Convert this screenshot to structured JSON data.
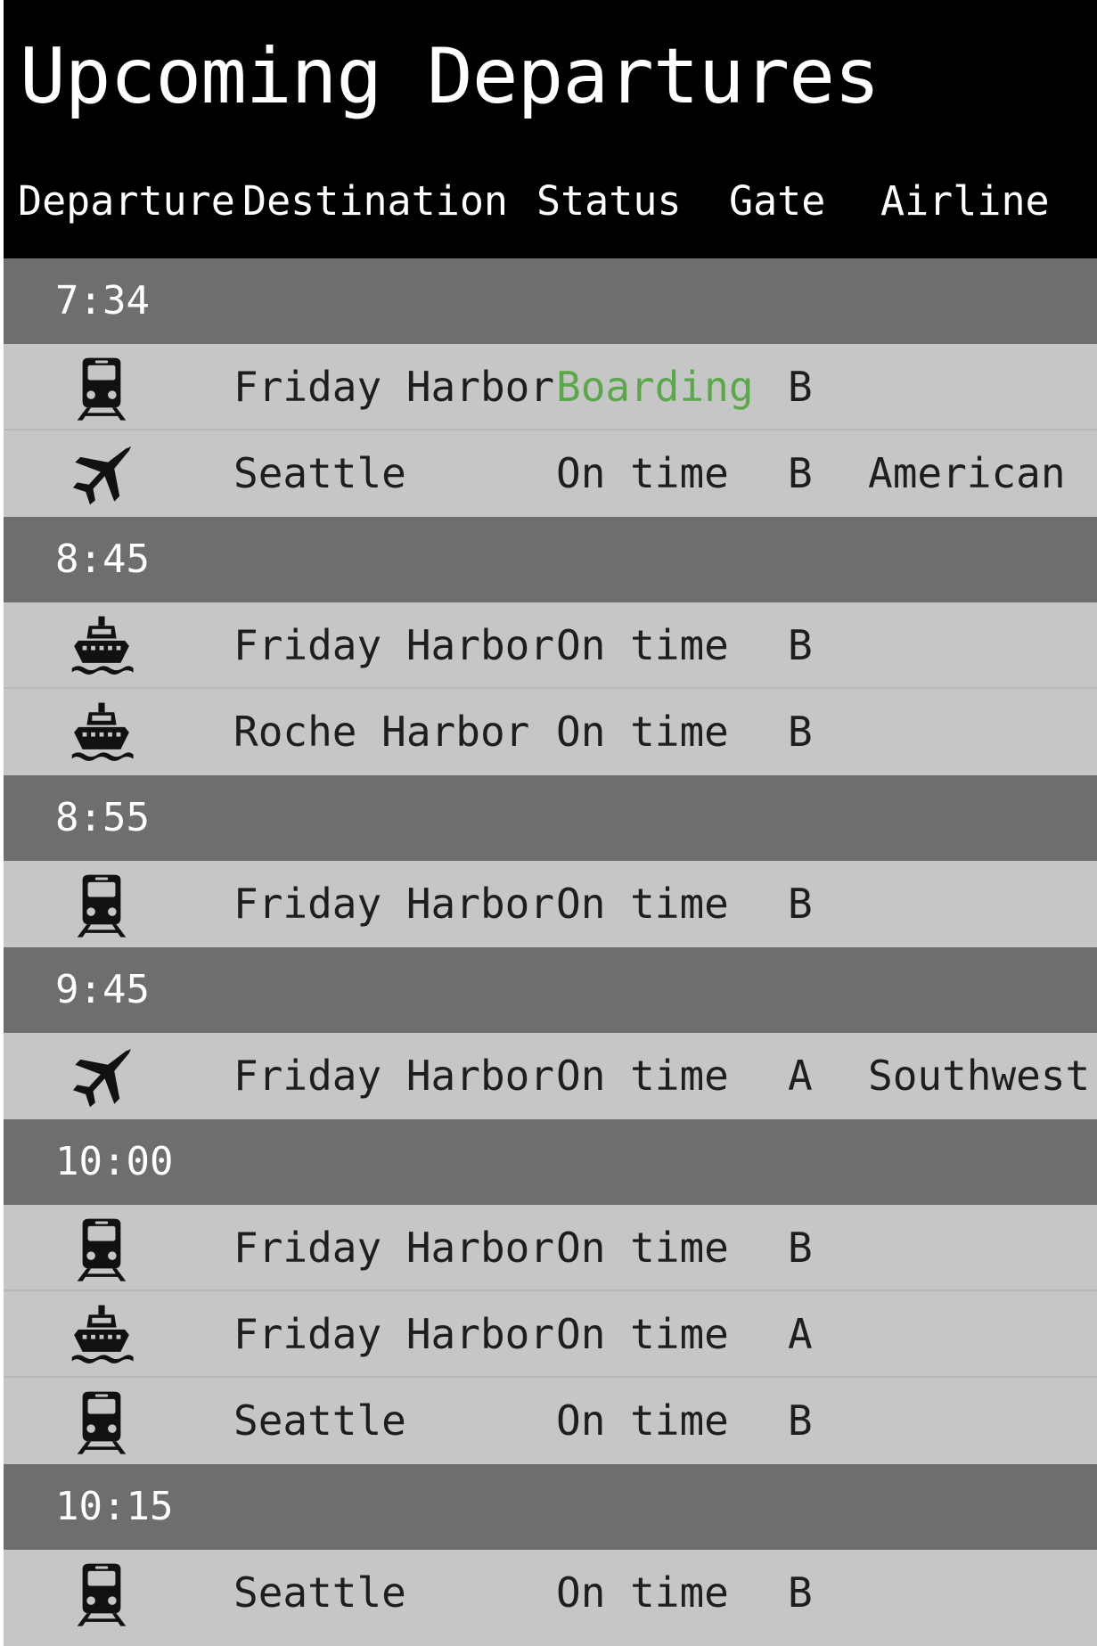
{
  "board": {
    "title": "Upcoming Departures",
    "columns": {
      "departure": "Departure",
      "destination": "Destination",
      "status": "Status",
      "gate": "Gate",
      "airline": "Airline"
    }
  },
  "colors": {
    "header_bg": "#000000",
    "time_row_bg": "#6e6e70",
    "row_bg": "#c6c6c6",
    "boarding": "#5aa84a"
  },
  "groups": [
    {
      "time": "7:34",
      "departures": [
        {
          "icon": "train-icon",
          "destination": "Friday Harbor",
          "status": "Boarding",
          "gate": "B",
          "airline": ""
        },
        {
          "icon": "plane-icon",
          "destination": "Seattle",
          "status": "On time",
          "gate": "B",
          "airline": "American"
        }
      ]
    },
    {
      "time": "8:45",
      "departures": [
        {
          "icon": "ferry-icon",
          "destination": "Friday Harbor",
          "status": "On time",
          "gate": "B",
          "airline": ""
        },
        {
          "icon": "ferry-icon",
          "destination": "Roche Harbor",
          "status": "On time",
          "gate": "B",
          "airline": ""
        }
      ]
    },
    {
      "time": "8:55",
      "departures": [
        {
          "icon": "train-icon",
          "destination": "Friday Harbor",
          "status": "On time",
          "gate": "B",
          "airline": ""
        }
      ]
    },
    {
      "time": "9:45",
      "departures": [
        {
          "icon": "plane-icon",
          "destination": "Friday Harbor",
          "status": "On time",
          "gate": "A",
          "airline": "Southwest"
        }
      ]
    },
    {
      "time": "10:00",
      "departures": [
        {
          "icon": "train-icon",
          "destination": "Friday Harbor",
          "status": "On time",
          "gate": "B",
          "airline": ""
        },
        {
          "icon": "ferry-icon",
          "destination": "Friday Harbor",
          "status": "On time",
          "gate": "A",
          "airline": ""
        },
        {
          "icon": "train-icon",
          "destination": "Seattle",
          "status": "On time",
          "gate": "B",
          "airline": ""
        }
      ]
    },
    {
      "time": "10:15",
      "departures": [
        {
          "icon": "train-icon",
          "destination": "Seattle",
          "status": "On time",
          "gate": "B",
          "airline": ""
        }
      ]
    }
  ]
}
